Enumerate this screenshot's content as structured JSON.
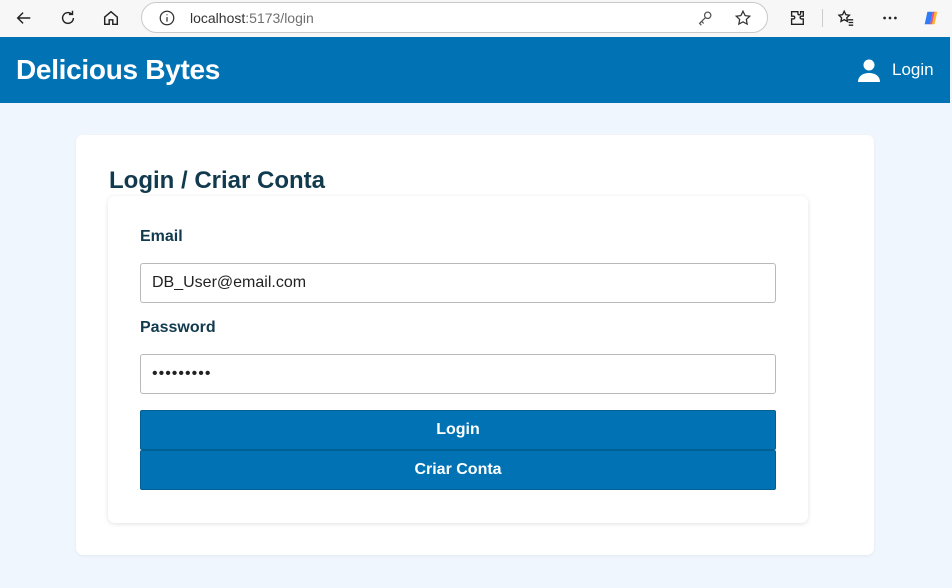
{
  "browser": {
    "url_host": "localhost",
    "url_path": ":5173/login"
  },
  "header": {
    "brand": "Delicious Bytes",
    "login_label": "Login"
  },
  "main": {
    "title": "Login / Criar Conta",
    "email_label": "Email",
    "email_value": "DB_User@email.com",
    "password_label": "Password",
    "password_value": "•••••••••",
    "login_button": "Login",
    "create_button": "Criar Conta"
  },
  "colors": {
    "primary": "#0173b4",
    "page_bg": "#f0f6fd",
    "title_text": "#123a4e"
  }
}
